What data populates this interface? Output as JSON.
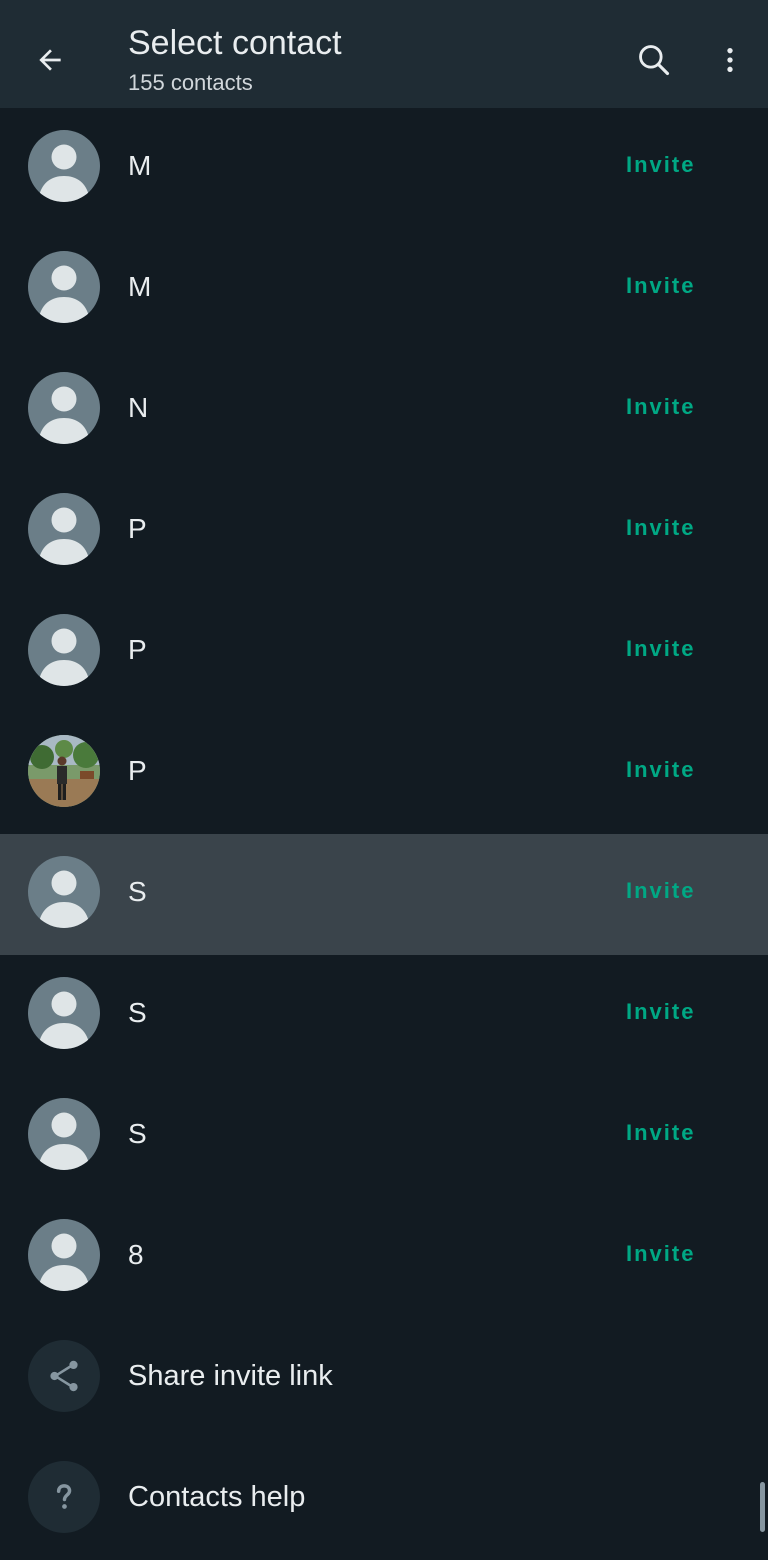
{
  "header": {
    "title": "Select contact",
    "subtitle": "155 contacts",
    "icons": {
      "back": "arrow-left-icon",
      "search": "search-icon",
      "menu": "more-vert-icon"
    }
  },
  "contacts": [
    {
      "name": "M",
      "action": "Invite",
      "avatar": "default"
    },
    {
      "name": "M",
      "action": "Invite",
      "avatar": "default"
    },
    {
      "name": "N",
      "action": "Invite",
      "avatar": "default"
    },
    {
      "name": "P",
      "action": "Invite",
      "avatar": "default"
    },
    {
      "name": "P",
      "action": "Invite",
      "avatar": "default"
    },
    {
      "name": "P",
      "action": "Invite",
      "avatar": "photo"
    },
    {
      "name": "S",
      "action": "Invite",
      "avatar": "default",
      "highlighted": true
    },
    {
      "name": "S",
      "action": "Invite",
      "avatar": "default"
    },
    {
      "name": "S",
      "action": "Invite",
      "avatar": "default"
    },
    {
      "name": "8",
      "action": "Invite",
      "avatar": "default"
    }
  ],
  "actions": {
    "share_invite": {
      "label": "Share invite link",
      "icon": "share-icon"
    },
    "contacts_help": {
      "label": "Contacts help",
      "icon": "help-icon"
    }
  },
  "colors": {
    "background": "#121b22",
    "appbar": "#1f2c34",
    "accent": "#00a884",
    "highlight": "#3a444b"
  }
}
